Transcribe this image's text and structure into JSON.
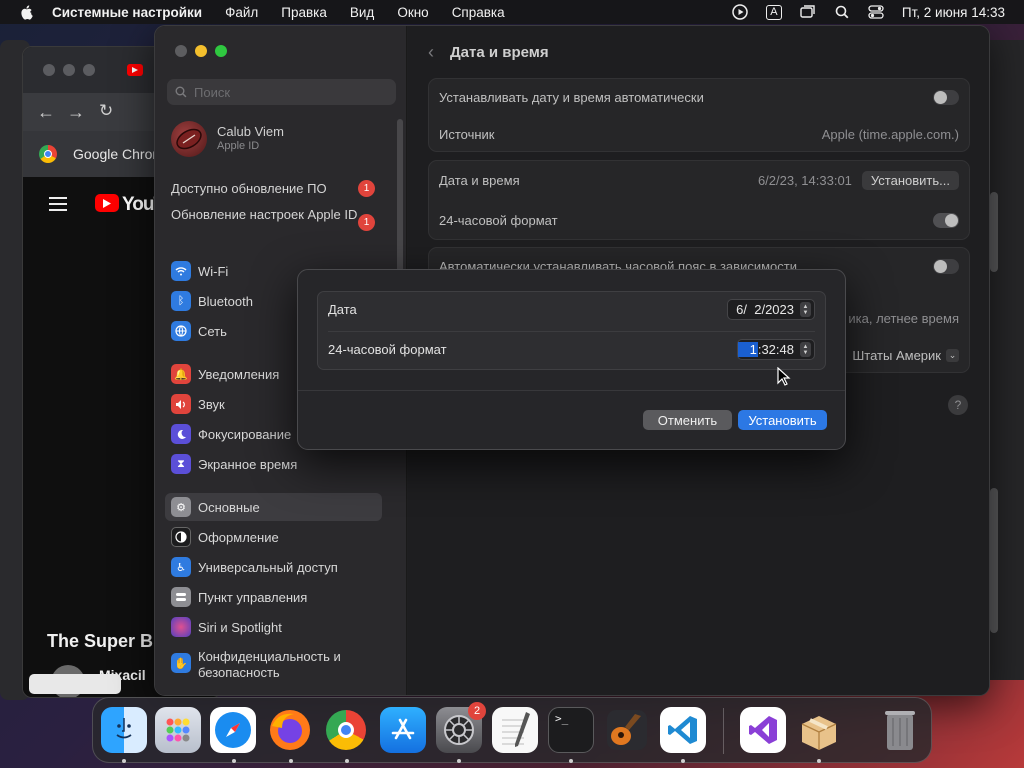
{
  "menubar": {
    "app_name": "Системные настройки",
    "items": [
      "Файл",
      "Правка",
      "Вид",
      "Окно",
      "Справка"
    ],
    "status": {
      "keyboard": "A",
      "clock": "Пт, 2 июня  14:33"
    }
  },
  "chrome": {
    "tab_label": "Google Chrome",
    "youtube_label": "YouTube",
    "video_title": "The Super Bi",
    "channel_text": "Mixacil"
  },
  "settings": {
    "search_placeholder": "Поиск",
    "account": {
      "name": "Calub Viem",
      "subtitle": "Apple ID"
    },
    "updates": [
      {
        "label": "Доступно обновление ПО",
        "count": "1"
      },
      {
        "label": "Обновление настроек Apple ID",
        "count": "1"
      }
    ],
    "sidebar_items": [
      {
        "label": "Wi-Fi",
        "icon": "wifi-icon",
        "color": "#2f7be0"
      },
      {
        "label": "Bluetooth",
        "icon": "bluetooth-icon",
        "color": "#2f7be0"
      },
      {
        "label": "Сеть",
        "icon": "network-icon",
        "color": "#2f7be0"
      },
      {
        "label": "Уведомления",
        "icon": "bell-icon",
        "color": "#e0443c"
      },
      {
        "label": "Звук",
        "icon": "speaker-icon",
        "color": "#e0443c"
      },
      {
        "label": "Фокусирование",
        "icon": "moon-icon",
        "color": "#5b4fd8"
      },
      {
        "label": "Экранное время",
        "icon": "hourglass-icon",
        "color": "#5b4fd8"
      },
      {
        "label": "Основные",
        "icon": "gear-icon",
        "color": "#8e8e93"
      },
      {
        "label": "Оформление",
        "icon": "appearance-icon",
        "color": "#1c1c1e"
      },
      {
        "label": "Универсальный доступ",
        "icon": "accessibility-icon",
        "color": "#2f7be0"
      },
      {
        "label": "Пункт управления",
        "icon": "control-center-icon",
        "color": "#8e8e93"
      },
      {
        "label": "Siri и Spotlight",
        "icon": "siri-icon",
        "color": "#c04090"
      },
      {
        "label": "Конфиденциальность и безопасность",
        "icon": "hand-icon",
        "color": "#2f7be0"
      }
    ],
    "pane": {
      "title": "Дата и время",
      "rows": {
        "auto_set": "Устанавливать дату и время автоматически",
        "source_label": "Источник",
        "source_value": "Apple (time.apple.com.)",
        "datetime_label": "Дата и время",
        "datetime_value": "6/2/23, 14:33:01",
        "set_button": "Установить...",
        "format24": "24-часовой формат",
        "auto_tz": "Автоматически устанавливать часовой пояс в зависимости",
        "tz_note": "ика, летнее время",
        "region": "Штаты Америк"
      },
      "help": "?"
    }
  },
  "dialog": {
    "date_label": "Дата",
    "date_value": "6/  2/2023",
    "format_label": "24-часовой формат",
    "time_selected": "1",
    "time_rest": ":32:48",
    "cancel": "Отменить",
    "ok": "Установить"
  },
  "dock": {
    "badge": "2",
    "apps": [
      "Finder",
      "Launchpad",
      "Safari",
      "Firefox",
      "Google Chrome",
      "App Store",
      "Системные настройки",
      "TextEdit",
      "Терминал",
      "GarageBand",
      "Visual Studio Code",
      "Visual Studio",
      "Installer",
      "Корзина"
    ]
  }
}
